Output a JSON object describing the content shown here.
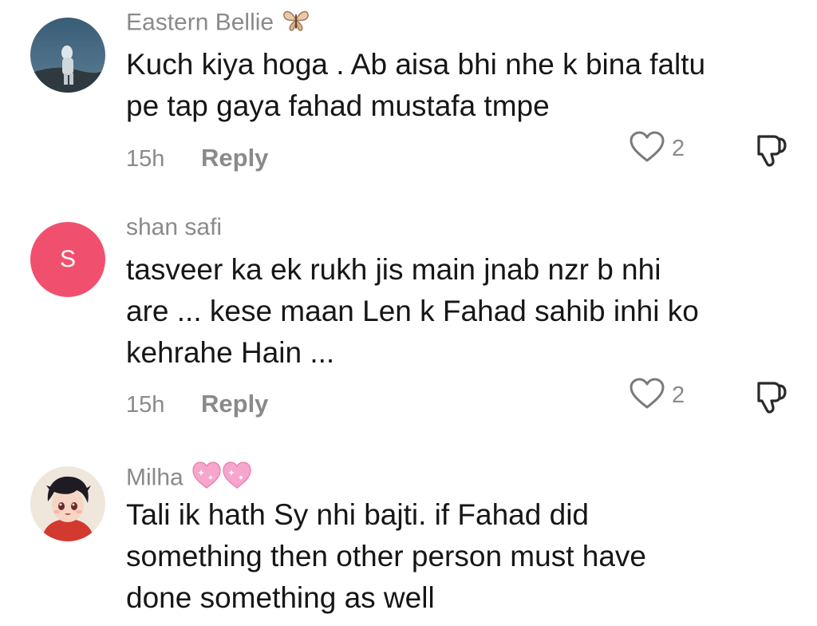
{
  "comments": [
    {
      "username": "Eastern Bellie",
      "username_emoji": "butterfly-emoji",
      "text_lines": [
        "Kuch kiya hoga . Ab aisa bhi nhe k bina faltu",
        "pe tap gaya fahad mustafa tmpe"
      ],
      "time": "15h",
      "reply_label": "Reply",
      "likes": "2",
      "avatar": "photo-avatar"
    },
    {
      "username": "shan safi",
      "avatar_letter": "S",
      "avatar_color": "#f0506e",
      "text_lines": [
        "tasveer ka ek rukh jis main jnab nzr b nhi",
        "are ... kese maan Len k Fahad sahib inhi ko",
        "kehrahe Hain ..."
      ],
      "time": "15h",
      "reply_label": "Reply",
      "likes": "2"
    },
    {
      "username": "Milha",
      "username_emoji": "sparkling-heart-emoji",
      "text_lines": [
        "Tali ik hath Sy nhi bajti. if Fahad did",
        "something then other person must have",
        "done something as well"
      ],
      "avatar": "anime-avatar"
    }
  ],
  "colors": {
    "meta_gray": "#8a8a8a",
    "text_dark": "#161616",
    "avatar_pink": "#f0506e"
  }
}
